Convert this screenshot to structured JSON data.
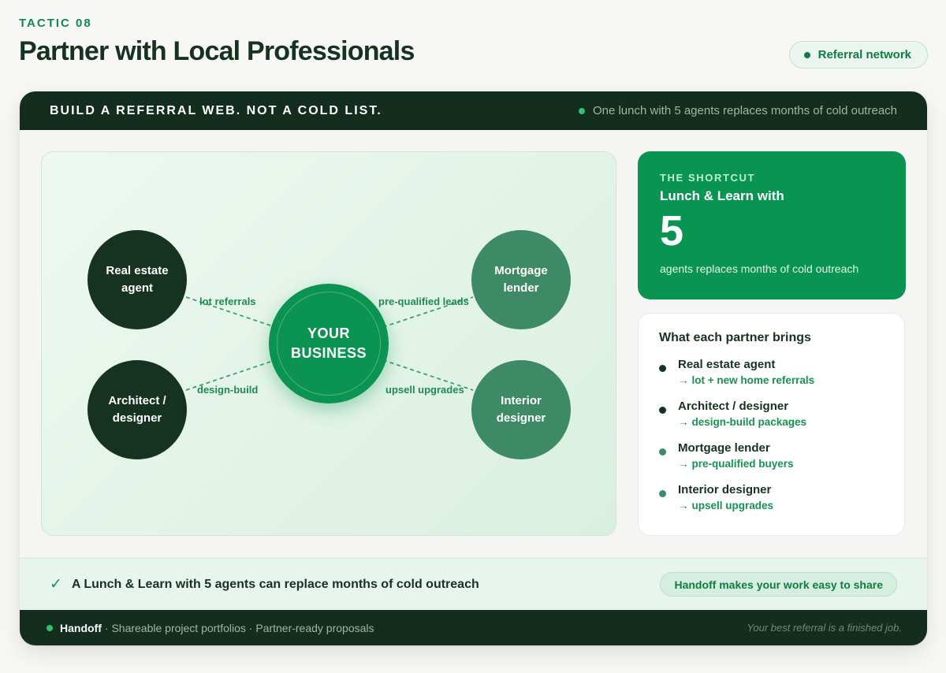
{
  "header": {
    "eyebrow": "TACTIC 08",
    "title": "Partner with Local Professionals",
    "pill": "Referral network"
  },
  "card_header": {
    "title": "BUILD A REFERRAL WEB. NOT A COLD LIST.",
    "note": "One lunch with 5 agents replaces months of cold outreach"
  },
  "diagram": {
    "center": "YOUR BUSINESS",
    "nodes": [
      {
        "label": "Real estate agent",
        "edge": "lot referrals"
      },
      {
        "label": "Architect / designer",
        "edge": "design-build"
      },
      {
        "label": "Mortgage lender",
        "edge": "pre-qualified leads"
      },
      {
        "label": "Interior designer",
        "edge": "upsell upgrades"
      }
    ]
  },
  "shortcut": {
    "eyebrow": "THE SHORTCUT",
    "title": "Lunch & Learn with",
    "number": "5",
    "caption": "agents replaces months of cold outreach"
  },
  "brings": {
    "title": "What each partner brings",
    "arrow": "→",
    "items": [
      {
        "name": "Real estate agent",
        "desc": "lot + new home referrals",
        "color": "#163322"
      },
      {
        "name": "Architect / designer",
        "desc": "design-build packages",
        "color": "#163322"
      },
      {
        "name": "Mortgage lender",
        "desc": "pre-qualified buyers",
        "color": "#3f8a66"
      },
      {
        "name": "Interior designer",
        "desc": "upsell upgrades",
        "color": "#3f8a66"
      }
    ]
  },
  "takeaway": {
    "text": "A Lunch & Learn with 5 agents can replace months of cold outreach",
    "pill": "Handoff makes your work easy to share"
  },
  "footer": {
    "brand": "Handoff",
    "items": "· Shareable project portfolios · Partner-ready proposals",
    "tagline": "Your best referral is a finished job."
  },
  "colors": {
    "brand_green": "#0a9451",
    "dark_green": "#132e1e",
    "node_dark": "#163322",
    "node_mid": "#3f8a66"
  }
}
